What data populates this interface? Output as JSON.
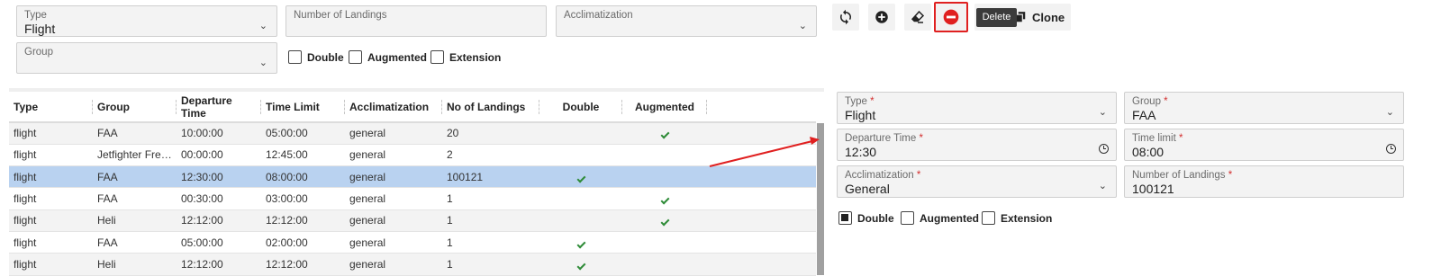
{
  "filters": {
    "type": {
      "label": "Type",
      "value": "Flight"
    },
    "landings": {
      "label": "Number of Landings",
      "value": ""
    },
    "acclimatization": {
      "label": "Acclimatization",
      "value": ""
    },
    "group": {
      "label": "Group",
      "value": ""
    },
    "checkboxes": [
      {
        "label": "Double",
        "checked": false
      },
      {
        "label": "Augmented",
        "checked": false
      },
      {
        "label": "Extension",
        "checked": false
      }
    ]
  },
  "toolbar": {
    "icons": [
      "refresh-icon",
      "add-circle-icon",
      "eraser-icon",
      "delete-circle-icon",
      "copy-icon"
    ],
    "delete_tooltip": "Delete",
    "clone_label": "Clone"
  },
  "table": {
    "columns": [
      "Type",
      "Group",
      "Departure Time",
      "Time Limit",
      "Acclimatization",
      "No of Landings",
      "Double",
      "Augmented"
    ],
    "rows": [
      {
        "type": "flight",
        "group": "FAA",
        "departure": "10:00:00",
        "limit": "05:00:00",
        "accl": "general",
        "landings": "20",
        "double": false,
        "augmented": true
      },
      {
        "type": "flight",
        "group": "Jetfighter Freelancer",
        "departure": "00:00:00",
        "limit": "12:45:00",
        "accl": "general",
        "landings": "2",
        "double": false,
        "augmented": false
      },
      {
        "type": "flight",
        "group": "FAA",
        "departure": "12:30:00",
        "limit": "08:00:00",
        "accl": "general",
        "landings": "100121",
        "double": true,
        "augmented": false,
        "selected": true
      },
      {
        "type": "flight",
        "group": "FAA",
        "departure": "00:30:00",
        "limit": "03:00:00",
        "accl": "general",
        "landings": "1",
        "double": false,
        "augmented": true
      },
      {
        "type": "flight",
        "group": "Heli",
        "departure": "12:12:00",
        "limit": "12:12:00",
        "accl": "general",
        "landings": "1",
        "double": false,
        "augmented": true
      },
      {
        "type": "flight",
        "group": "FAA",
        "departure": "05:00:00",
        "limit": "02:00:00",
        "accl": "general",
        "landings": "1",
        "double": true,
        "augmented": false
      },
      {
        "type": "flight",
        "group": "Heli",
        "departure": "12:12:00",
        "limit": "12:12:00",
        "accl": "general",
        "landings": "1",
        "double": true,
        "augmented": false
      }
    ]
  },
  "form": {
    "type": {
      "label": "Type",
      "value": "Flight",
      "required": "*"
    },
    "group": {
      "label": "Group",
      "value": "FAA",
      "required": "*"
    },
    "departure": {
      "label": "Departure Time",
      "value": "12:30",
      "required": "*"
    },
    "limit": {
      "label": "Time limit",
      "value": "08:00",
      "required": "*"
    },
    "acclimatization": {
      "label": "Acclimatization",
      "value": "General",
      "required": "*"
    },
    "landings": {
      "label": "Number of Landings",
      "value": "100121",
      "required": "*"
    },
    "checkboxes": [
      {
        "label": "Double",
        "checked": true
      },
      {
        "label": "Augmented",
        "checked": false
      },
      {
        "label": "Extension",
        "checked": false
      }
    ]
  },
  "colors": {
    "accent_red": "#e02020",
    "selected_row": "#b9d2f0",
    "check_green": "#2e8b37"
  }
}
